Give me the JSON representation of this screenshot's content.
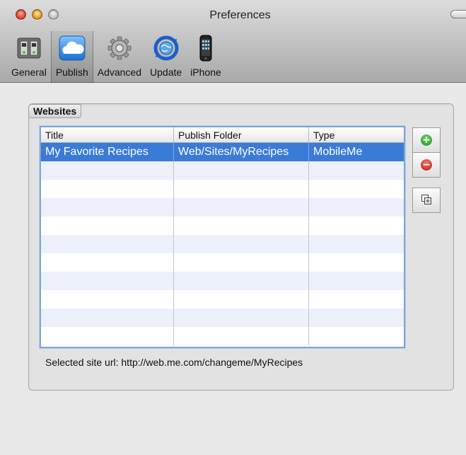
{
  "window": {
    "title": "Preferences"
  },
  "toolbar": {
    "items": [
      {
        "label": "General",
        "icon": "general-switches-icon"
      },
      {
        "label": "Publish",
        "icon": "cloud-icon"
      },
      {
        "label": "Advanced",
        "icon": "gear-icon"
      },
      {
        "label": "Update",
        "icon": "sync-globe-icon"
      },
      {
        "label": "iPhone",
        "icon": "iphone-icon"
      }
    ],
    "selected": "Publish"
  },
  "websites": {
    "group_label": "Websites",
    "columns": [
      "Title",
      "Publish Folder",
      "Type"
    ],
    "rows": [
      [
        "My Favorite Recipes",
        "Web/Sites/MyRecipes",
        "MobileMe"
      ]
    ],
    "selected_row": 0,
    "url_label": "Selected site url:",
    "url_value": "http://web.me.com/changeme/MyRecipes"
  },
  "colors": {
    "selection": "#3a7bd8",
    "alt_row": "#ebf0fb",
    "add_green": "#1f8b1a",
    "remove_red": "#b5140a"
  }
}
